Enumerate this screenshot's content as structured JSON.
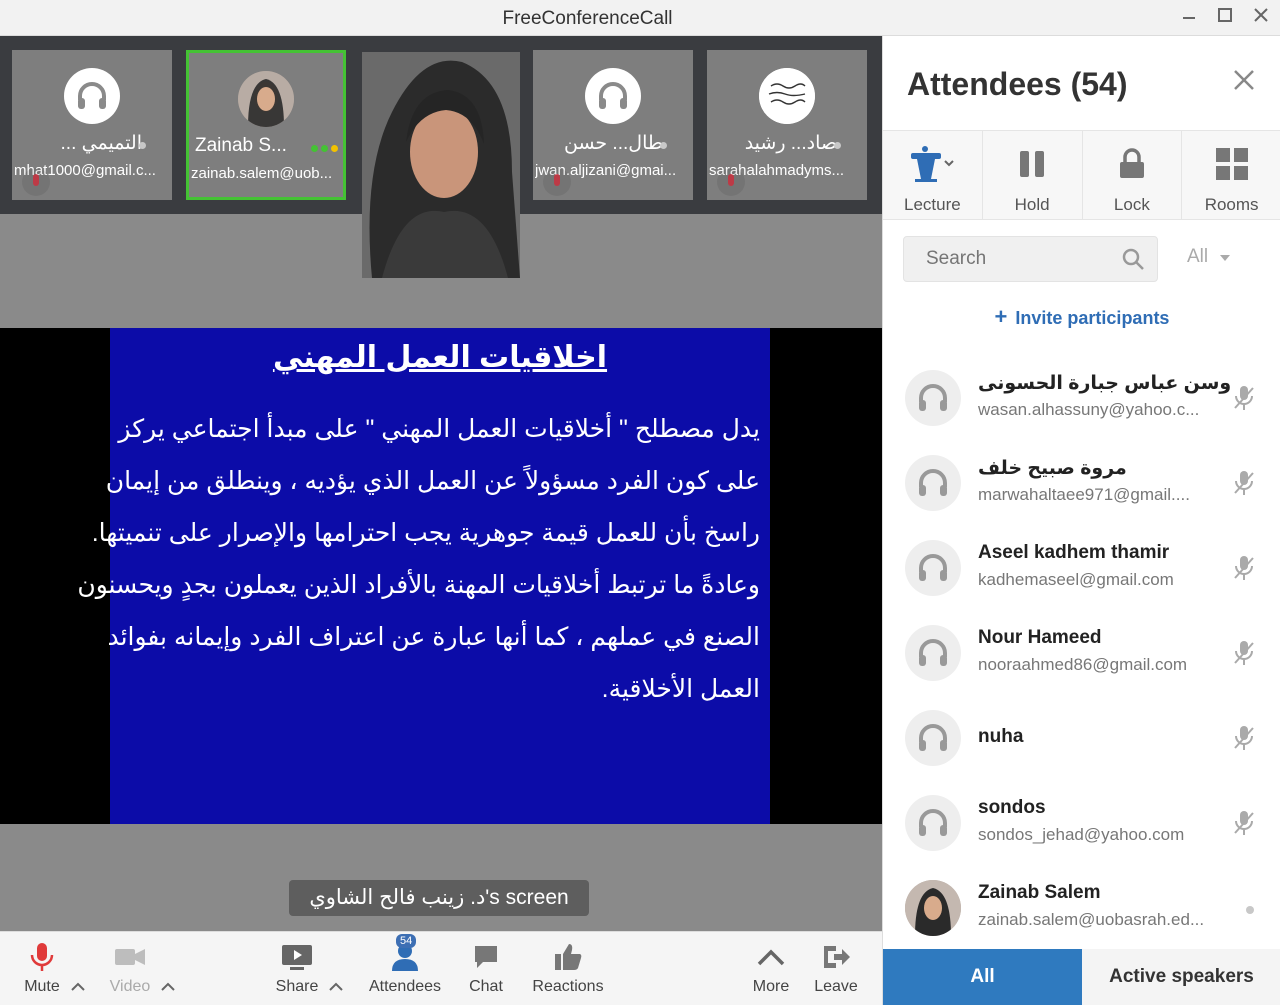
{
  "window": {
    "title": "FreeConferenceCall"
  },
  "tiles": [
    {
      "name": "... التميمي",
      "email": "mhat1000@gmail.c..."
    },
    {
      "name": "Zainab S...",
      "email": "zainab.salem@uob..."
    },
    {
      "name": "طال... حسن",
      "email": "jwan.aljizani@gmai..."
    },
    {
      "name": "صاد... رشيد",
      "email": "sarahalahmadyms..."
    }
  ],
  "slide": {
    "title": "اخلاقيات العمل المهني",
    "lines": [
      "يدل مصطلح \" أخلاقيات العمل المهني \" على مبدأ اجتماعي يركز",
      "على كون الفرد مسؤولاً عن العمل الذي يؤديه ، وينطلق من إيمان",
      "راسخ بأن للعمل قيمة جوهرية يجب احترامها والإصرار على تنميتها.",
      "وعادةً ما ترتبط أخلاقيات المهنة بالأفراد الذين يعملون بجدٍ ويحسنون",
      "الصنع في عملهم ، كما أنها عبارة عن اعتراف الفرد وإيمانه بفوائد",
      "العمل الأخلاقية."
    ]
  },
  "screen_label": "د. زينب فالح الشاوي's screen",
  "toolbar": {
    "mute": "Mute",
    "video": "Video",
    "share": "Share",
    "attendees": "Attendees",
    "attendees_badge": "54",
    "chat": "Chat",
    "reactions": "Reactions",
    "more": "More",
    "leave": "Leave"
  },
  "panel": {
    "title": "Attendees (54)",
    "controls": {
      "lecture": "Lecture",
      "hold": "Hold",
      "lock": "Lock",
      "rooms": "Rooms"
    },
    "search_placeholder": "Search",
    "filter": "All",
    "invite": "Invite participants",
    "attendees": [
      {
        "name": "وسن عباس جبارة الحسونى",
        "email": "wasan.alhassuny@yahoo.c..."
      },
      {
        "name": "مروة صبيح خلف",
        "email": "marwahaltaee971@gmail...."
      },
      {
        "name": "Aseel kadhem thamir",
        "email": "kadhemaseel@gmail.com"
      },
      {
        "name": "Nour Hameed",
        "email": "nooraahmed86@gmail.com"
      },
      {
        "name": "nuha",
        "email": ""
      },
      {
        "name": "sondos",
        "email": "sondos_jehad@yahoo.com"
      },
      {
        "name": "Zainab Salem",
        "email": "zainab.salem@uobasrah.ed..."
      }
    ],
    "tabs": {
      "all": "All",
      "active_speakers": "Active speakers"
    }
  },
  "colors": {
    "accent": "#2f7abf",
    "slide_bg": "#0c0ca8",
    "active_tile": "#44c234",
    "mute_red": "#e03a3a"
  }
}
